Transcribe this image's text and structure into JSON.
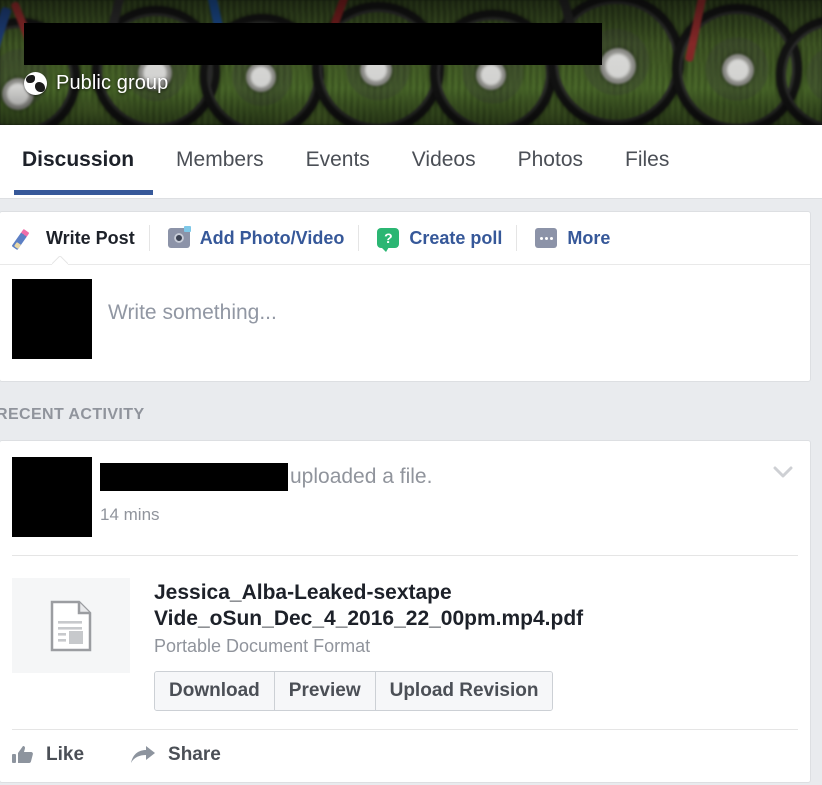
{
  "cover": {
    "group_name_redacted": true,
    "privacy_label": "Public group",
    "globe_icon": "globe-icon"
  },
  "tabs": [
    {
      "label": "Discussion",
      "active": true
    },
    {
      "label": "Members",
      "active": false
    },
    {
      "label": "Events",
      "active": false
    },
    {
      "label": "Videos",
      "active": false
    },
    {
      "label": "Photos",
      "active": false
    },
    {
      "label": "Files",
      "active": false
    }
  ],
  "composer": {
    "tabs": [
      {
        "label": "Write Post",
        "icon": "pencil-icon",
        "active": true
      },
      {
        "label": "Add Photo/Video",
        "icon": "camera-icon",
        "active": false
      },
      {
        "label": "Create poll",
        "icon": "poll-icon",
        "active": false
      },
      {
        "label": "More",
        "icon": "more-dots-icon",
        "active": false
      }
    ],
    "placeholder": "Write something...",
    "poll_icon_glyph": "?"
  },
  "section": {
    "recent_activity_title": "RECENT ACTIVITY"
  },
  "post": {
    "author_redacted": true,
    "action_text": "uploaded a file.",
    "timestamp": "14 mins",
    "menu_icon": "chevron-down-icon",
    "attachment": {
      "thumbnail_icon": "document-icon",
      "file_name": "Jessica_Alba-Leaked-sextape Vide_oSun_Dec_4_2016_22_00pm.mp4.pdf",
      "file_type": "Portable Document Format",
      "buttons": [
        {
          "label": "Download"
        },
        {
          "label": "Preview"
        },
        {
          "label": "Upload Revision"
        }
      ]
    },
    "actions": [
      {
        "label": "Like",
        "icon": "thumbs-up-icon"
      },
      {
        "label": "Share",
        "icon": "share-arrow-icon"
      }
    ]
  },
  "colors": {
    "brand_blue": "#365899",
    "link_blue": "#365899",
    "page_bg": "#e9ebee",
    "text_dark": "#1d2129",
    "text_muted": "#90949c",
    "poll_green": "#2bb673"
  }
}
